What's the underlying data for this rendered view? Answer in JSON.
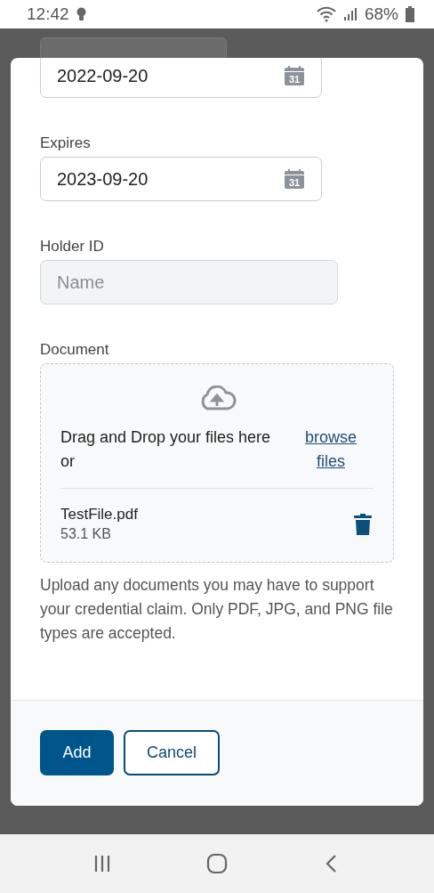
{
  "status_bar": {
    "time": "12:42",
    "battery": "68%"
  },
  "form": {
    "fields": [
      {
        "kind": "date",
        "value": "2022-09-20",
        "icon_text": "31"
      },
      {
        "kind": "date",
        "label": "Expires",
        "value": "2023-09-20",
        "icon_text": "31"
      },
      {
        "kind": "text",
        "label": "Holder ID",
        "placeholder": "Name"
      }
    ],
    "document": {
      "label": "Document",
      "prompt": "Drag and Drop your files here or",
      "browse_link": "browse files",
      "files": [
        {
          "name": "TestFile.pdf",
          "size": "53.1 KB"
        }
      ],
      "help": "Upload any documents you may have to support your credential claim. Only PDF, JPG, and PNG file types are accepted."
    }
  },
  "buttons": [
    {
      "label": "Add",
      "kind": "primary"
    },
    {
      "label": "Cancel",
      "kind": "secondary"
    }
  ]
}
